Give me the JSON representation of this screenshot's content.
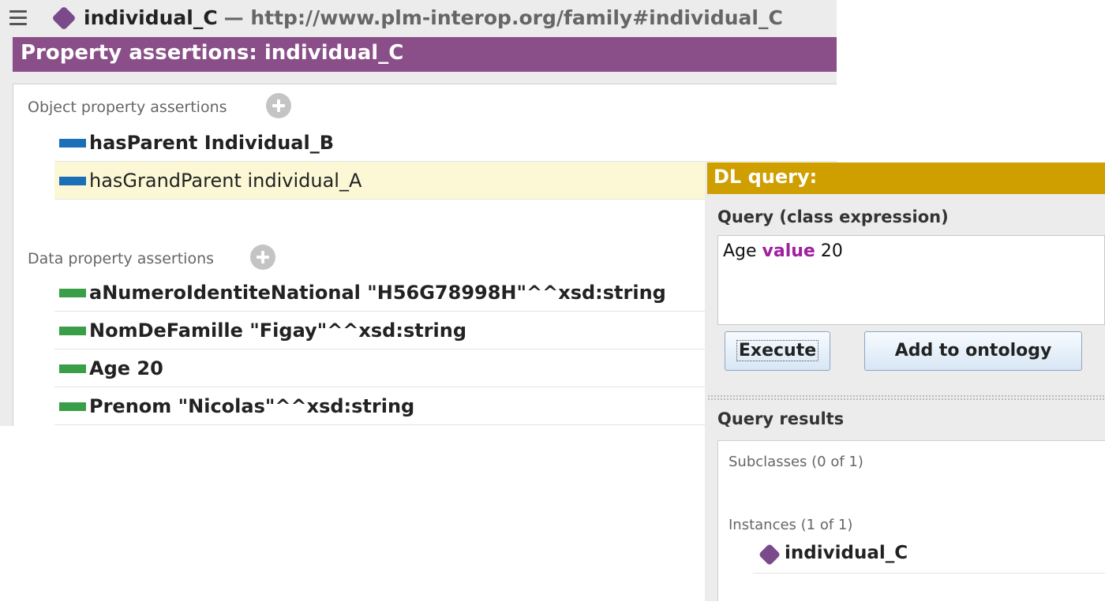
{
  "header": {
    "individual_name": "individual_C",
    "iri": "— http://www.plm-interop.org/family#individual_C"
  },
  "property_assertions": {
    "title": "Property assertions: individual_C",
    "object_section_label": "Object property assertions",
    "object_rows": [
      {
        "text": "hasParent  Individual_B",
        "bold": true,
        "swatch": "blue"
      },
      {
        "text": "hasGrandParent  individual_A",
        "bold": false,
        "swatch": "blue",
        "selected": true
      }
    ],
    "data_section_label": "Data property assertions",
    "data_rows": [
      {
        "text": "aNumeroIdentiteNational  \"H56G78998H\"^^xsd:string",
        "swatch": "green"
      },
      {
        "text": "NomDeFamille  \"Figay\"^^xsd:string",
        "swatch": "green"
      },
      {
        "text": "Age  20",
        "swatch": "green"
      },
      {
        "text": "Prenom  \"Nicolas\"^^xsd:string",
        "swatch": "green"
      }
    ]
  },
  "dl_query": {
    "title": "DL query:",
    "query_label": "Query (class expression)",
    "query": {
      "part1": "Age ",
      "keyword": "value",
      "part2": " 20"
    },
    "execute_label": "Execute",
    "add_label": "Add to ontology",
    "results_label": "Query results",
    "subclasses_label": "Subclasses (0 of 1)",
    "instances_label": "Instances (1 of 1)",
    "instance_result": "individual_C"
  },
  "colors": {
    "purple_header": "#8a4e88",
    "gold_header": "#cf9f00",
    "object_property": "#1b6fb6",
    "data_property": "#3a9e48",
    "individual": "#7a4a8a",
    "query_keyword": "#a020a0"
  }
}
